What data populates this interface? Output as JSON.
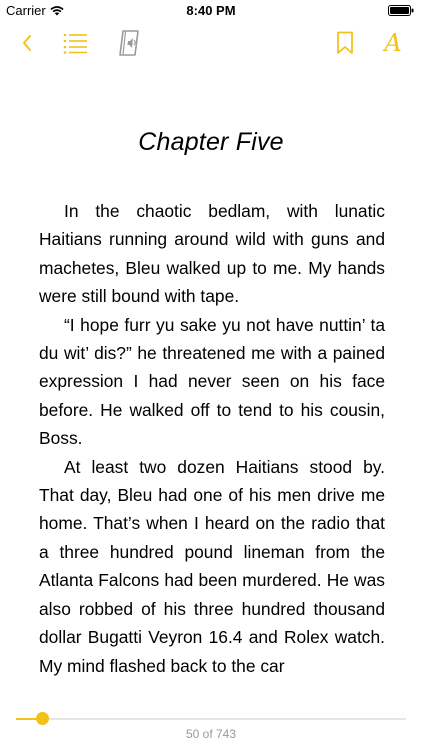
{
  "status_bar": {
    "carrier": "Carrier",
    "time": "8:40 PM",
    "wifi_icon": "wifi-icon",
    "battery_icon": "battery-icon"
  },
  "toolbar": {
    "accent_color": "#f2c21a",
    "back_icon": "chevron-left-icon",
    "toc_icon": "list-icon",
    "audio_icon": "audiobook-icon",
    "bookmark_icon": "bookmark-icon",
    "font_label": "A"
  },
  "content": {
    "chapter_title": "Chapter Five",
    "paragraphs": [
      "In the chaotic bedlam, with lunatic Haitians running around wild with guns and machetes, Bleu walked up to me. My hands were still bound with tape.",
      "“I hope furr yu sake yu not have nut­tin’ ta du wit’ dis?” he threatened me with a pained expression I had never seen on his face before. He walked off to tend to his cousin, Boss.",
      "At least two dozen Haitians stood by. That day, Bleu had one of his men drive me home. That’s when I heard on the radio that a three hundred pound lineman from the Atlanta Fal­cons had been murdered. He was also robbed of his three hundred thousand dollar Bugatti Veyron 16.4 and Rolex watch. My mind flashed back to the car"
    ]
  },
  "footer": {
    "page_label": "50 of 743",
    "current_page": 50,
    "total_pages": 743
  }
}
